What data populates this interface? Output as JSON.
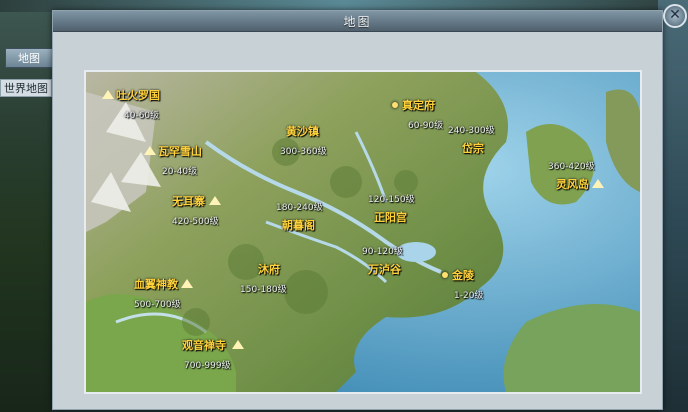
{
  "window": {
    "title": "地图"
  },
  "tabs": {
    "map": "地图",
    "world": "世界地图"
  },
  "close_symbol": "✕",
  "locations": [
    {
      "name": "吐火罗国",
      "level": "40-60级"
    },
    {
      "name": "瓦罕雪山",
      "level": "20-40级"
    },
    {
      "name": "无耳寨",
      "level": "420-500级"
    },
    {
      "name": "黄沙镇",
      "level": "300-360级"
    },
    {
      "name": "真定府",
      "level": "60-90级"
    },
    {
      "name": "岱宗",
      "level": "240-300级"
    },
    {
      "name": "灵风岛",
      "level": "360-420级"
    },
    {
      "name": "朝暮阁",
      "level": "180-240级"
    },
    {
      "name": "正阳宫",
      "level": "120-150级"
    },
    {
      "name": "万泸谷",
      "level": "90-120级"
    },
    {
      "name": "沐府",
      "level": "150-180级"
    },
    {
      "name": "金陵",
      "level": "1-20级"
    },
    {
      "name": "血翼神教",
      "level": "500-700级"
    },
    {
      "name": "观音禅寺",
      "level": "700-999级"
    }
  ]
}
